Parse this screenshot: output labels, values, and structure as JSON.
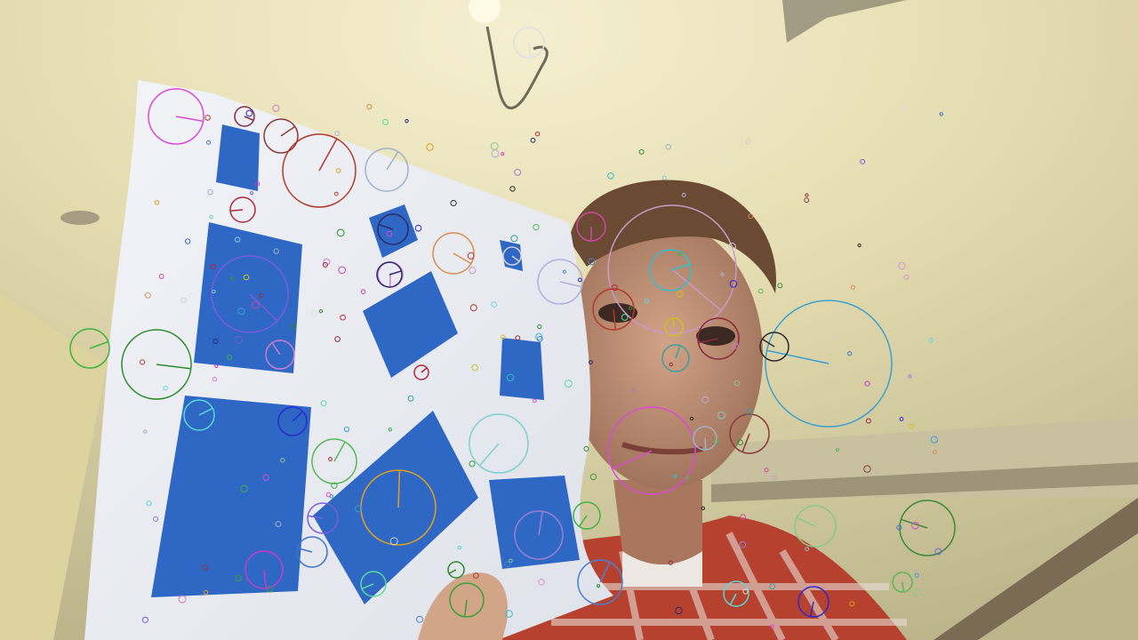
{
  "scene": {
    "description_tag": "keypoint-overlay-photo"
  },
  "colors": {
    "wall": "#e6dfb4",
    "wall_shadow": "#b9b08a",
    "paper": "#e9ecf3",
    "blue": "#2f67c4",
    "skin": "#c99a7f",
    "hair": "#6b4a33",
    "shirt_red": "#b6412e",
    "shirt_white": "#e9e4e0"
  },
  "keypoints": [
    {
      "c": "#d94ad8",
      "a": 350
    },
    {
      "c": "#8a2b3a",
      "a": 300
    },
    {
      "c": "#8a3a3a",
      "a": 320
    },
    {
      "c": "#b33a2a",
      "a": 310
    },
    {
      "c": "#9fb3c9",
      "a": 270
    },
    {
      "c": "#b3263a",
      "a": 0
    },
    {
      "c": "#2a2a6a",
      "a": 300
    },
    {
      "c": "#d07bd0",
      "a": 10
    },
    {
      "c": "#7b5be0",
      "a": 20
    },
    {
      "c": "#2a8c2a",
      "a": 20
    },
    {
      "c": "#3fb33f",
      "a": 10
    },
    {
      "c": "#5ad9d9",
      "a": 340
    },
    {
      "c": "#2a2ad0",
      "a": 320
    },
    {
      "c": "#58b858",
      "a": 300
    },
    {
      "c": "#e0a020",
      "a": 290
    },
    {
      "c": "#3f6fd0",
      "a": 330
    },
    {
      "c": "#5ad9a0",
      "a": 330
    },
    {
      "c": "#7fd0d0",
      "a": 320
    },
    {
      "c": "#c93ac9",
      "a": 330
    },
    {
      "c": "#3a9f3a",
      "a": 280
    },
    {
      "c": "#c99ac9",
      "a": 300
    },
    {
      "c": "#30c0d0",
      "a": 320
    },
    {
      "c": "#d0c020",
      "a": 0
    },
    {
      "c": "#3aa0a0",
      "a": 300
    },
    {
      "c": "#3aa0d0",
      "a": 0
    },
    {
      "c": "#8ac98a",
      "a": 310
    },
    {
      "c": "#3a8a3a",
      "a": 280
    },
    {
      "c": "#c94a9f",
      "a": 350
    },
    {
      "c": "#e0e0e0",
      "a": 320
    },
    {
      "c": "#d0d0d0",
      "a": 330
    },
    {
      "c": "#d89050",
      "a": 300
    },
    {
      "c": "#b0b0e0",
      "a": 280
    },
    {
      "c": "#4a80d0",
      "a": 320
    },
    {
      "c": "#9a7fd0",
      "a": 300
    },
    {
      "c": "#2a2a2a",
      "a": 330
    }
  ]
}
